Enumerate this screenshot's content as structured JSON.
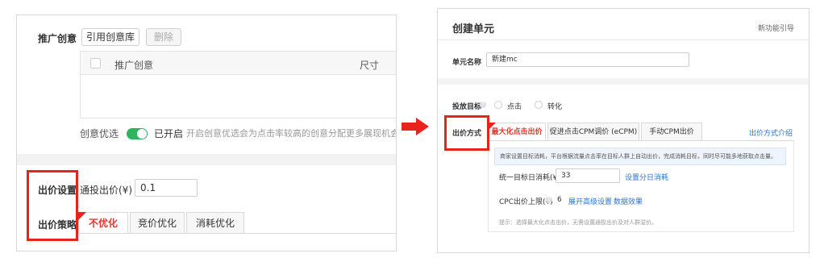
{
  "left": {
    "promo_label": "推广创意",
    "cite_button": "引用创意库",
    "delete_button": "删除",
    "table": {
      "col1": "推广创意",
      "col2": "尺寸"
    },
    "optimize_label": "创意优选",
    "optimize_state": "已开启",
    "optimize_hint": "开启创意优选会为点击率较高的创意分配更多展现机会",
    "bid_setting_label": "出价设置",
    "bid_label": "通投出价(¥)",
    "bid_value": "0.1",
    "strategy_label": "出价策略",
    "tabs": [
      "不优化",
      "竞价优化",
      "消耗优化"
    ],
    "active_tab": 0
  },
  "arrow": {
    "color": "#e8231b"
  },
  "right": {
    "title": "创建单元",
    "guide_link": "新功能引导",
    "unit_name_label": "单元名称",
    "unit_name_value": "新建mc",
    "target_label": "投放目标",
    "target_options": [
      "点击",
      "转化"
    ],
    "bid_method_label": "出价方式",
    "bid_tabs": [
      "最大化点击出价",
      "促进点击CPM调价 (eCPM)",
      "手动CPM出价"
    ],
    "bid_intro_link": "出价方式介绍",
    "info_text": "商家设置目标消耗，平台根据流量点击率在目标人群上自动出价，完成消耗目标，同时尽可能多地获取点击量。",
    "daily_label": "统一目标日消耗(¥)",
    "daily_value": "33",
    "daily_link": "设置分日消耗",
    "cpc_label": "CPC出价上限(¥)",
    "cpc_value": "6",
    "cpc_link1": "展开高级设置",
    "cpc_link2": "数据效果",
    "tip": "提示：选择最大化点击出价，无需设置通投出价及对人群溢价。"
  },
  "colors": {
    "accent_red": "#e8231b",
    "link_blue": "#2b73d3",
    "toggle_green": "#2fb35f"
  }
}
